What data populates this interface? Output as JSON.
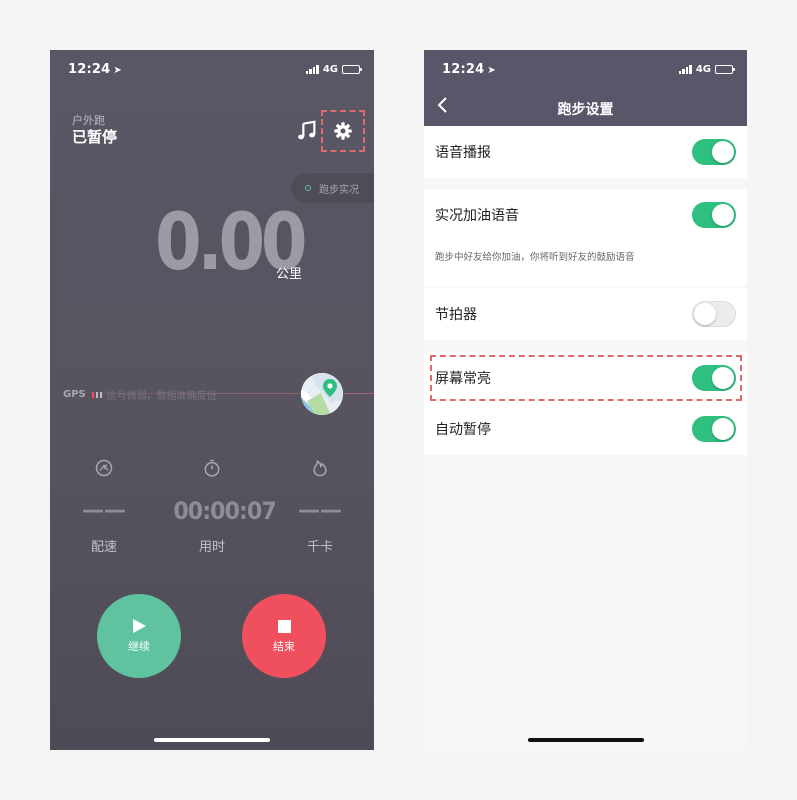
{
  "left": {
    "status_time": "12:24",
    "network": "4G",
    "run_type": "户外跑",
    "run_status": "已暂停",
    "live_label": "跑步实况",
    "distance": "0.00",
    "distance_unit": "公里",
    "gps": {
      "label": "GPS",
      "message": "信号微弱，数据准确度低"
    },
    "stats": [
      {
        "value": "——",
        "label": "配速"
      },
      {
        "value": "00:00:07",
        "label": "用时"
      },
      {
        "value": "——",
        "label": "千卡"
      }
    ],
    "continue_label": "继续",
    "stop_label": "结束",
    "colors": {
      "continue": "#5fc3a0",
      "stop": "#f0505e",
      "highlight": "#e06a6a"
    }
  },
  "right": {
    "status_time": "12:24",
    "network": "4G",
    "title": "跑步设置",
    "settings": [
      {
        "label": "语音播报",
        "on": true
      },
      {
        "label": "实况加油语音",
        "on": true
      },
      {
        "label": "节拍器",
        "on": false
      },
      {
        "label": "屏幕常亮",
        "on": true
      },
      {
        "label": "自动暂停",
        "on": true
      }
    ],
    "cheer_note": "跑步中好友给你加油，你将听到好友的鼓励语音",
    "colors": {
      "toggle_on": "#2fbf7f",
      "header": "#59566a"
    }
  }
}
